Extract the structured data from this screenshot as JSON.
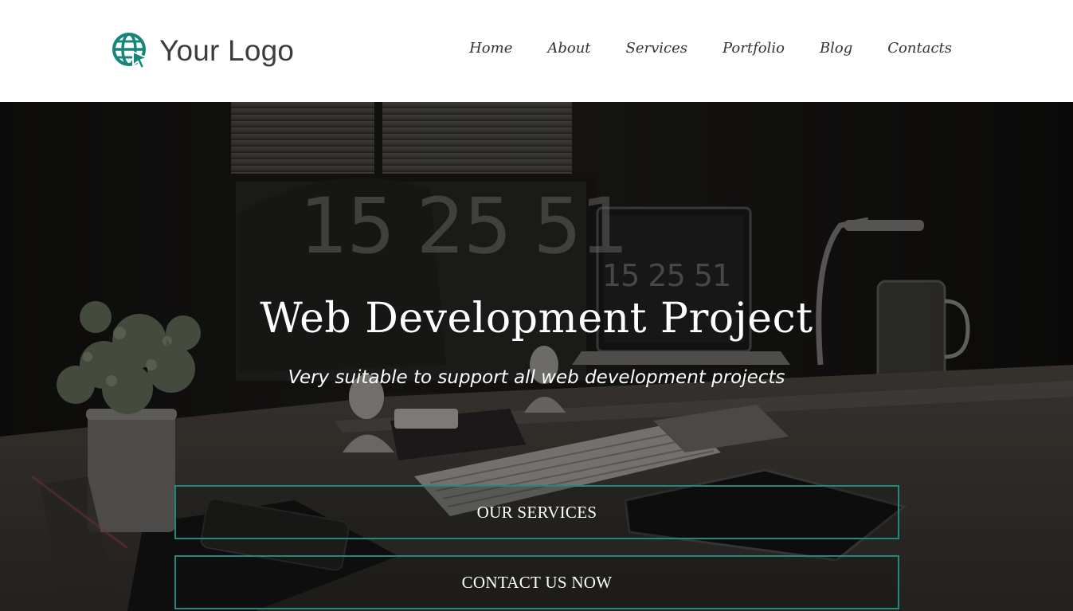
{
  "header": {
    "logo_text": "Your Logo",
    "logo_icon": "globe-cursor-icon",
    "brand_color": "#16867a",
    "nav": [
      {
        "label": "Home"
      },
      {
        "label": "About"
      },
      {
        "label": "Services"
      },
      {
        "label": "Portfolio"
      },
      {
        "label": "Blog"
      },
      {
        "label": "Contacts"
      }
    ]
  },
  "hero": {
    "background": "desk-workspace-photo",
    "clock_text": "15 25 51",
    "title": "Web Development Project",
    "subtitle": "Very suitable to support all web development projects",
    "buttons": [
      {
        "label": "OUR SERVICES"
      },
      {
        "label": "CONTACT US NOW"
      }
    ],
    "button_border_color": "#1f8a7c"
  }
}
